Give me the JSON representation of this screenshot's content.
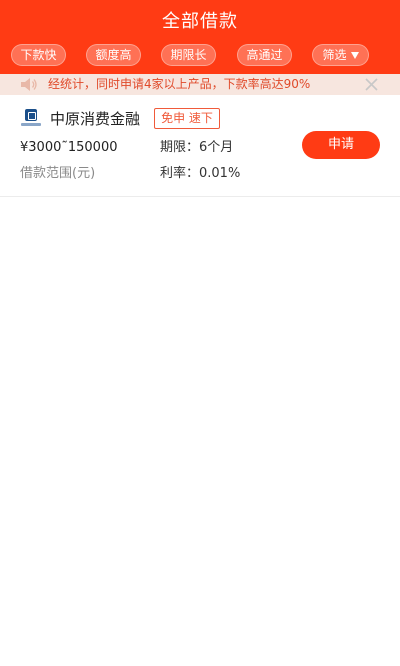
{
  "header": {
    "title": "全部借款"
  },
  "filters": [
    {
      "label": "下款快"
    },
    {
      "label": "额度高"
    },
    {
      "label": "期限长"
    },
    {
      "label": "高通过"
    },
    {
      "label": "筛选"
    }
  ],
  "notice": {
    "text": "经统计，同时申请4家以上产品，下款率高达90%"
  },
  "products": [
    {
      "name": "中原消费金融",
      "tag": "免申 速下",
      "amount": "¥3000˜150000",
      "amount_label": "借款范围(元)",
      "term": "期限：6个月",
      "rate": "利率：0.01%",
      "apply_label": "申请"
    }
  ],
  "colors": {
    "brand": "#ff3b14",
    "notice_bg": "#f7e6df",
    "notice_text": "#e04a2a",
    "tag": "#f05a3a"
  }
}
